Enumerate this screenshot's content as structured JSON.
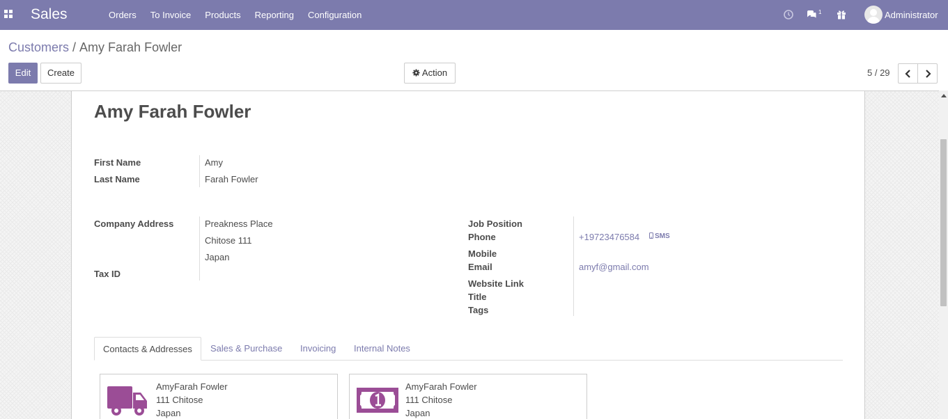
{
  "navbar": {
    "app_title": "Sales",
    "menu": [
      "Orders",
      "To Invoice",
      "Products",
      "Reporting",
      "Configuration"
    ],
    "chat_count": "1",
    "user_name": "Administrator"
  },
  "breadcrumb": {
    "parent": "Customers",
    "separator": "/",
    "current": "Amy Farah Fowler"
  },
  "buttons": {
    "edit": "Edit",
    "create": "Create",
    "action": "Action"
  },
  "pager": {
    "value": "5 / 29"
  },
  "partner": {
    "name": "Amy Farah Fowler",
    "first_name_label": "First Name",
    "first_name": "Amy",
    "last_name_label": "Last Name",
    "last_name": "Farah Fowler",
    "address_label": "Company Address",
    "street": "Preakness Place",
    "city_zip": "Chitose  111",
    "country": "Japan",
    "tax_id_label": "Tax ID",
    "job_position_label": "Job Position",
    "phone_label": "Phone",
    "phone": "+19723476584",
    "sms_label": "SMS",
    "mobile_label": "Mobile",
    "email_label": "Email",
    "email": "amyf@gmail.com",
    "website_label": "Website Link",
    "title_label": "Title",
    "tags_label": "Tags"
  },
  "tabs": [
    {
      "label": "Contacts & Addresses",
      "active": true
    },
    {
      "label": "Sales & Purchase",
      "active": false
    },
    {
      "label": "Invoicing",
      "active": false
    },
    {
      "label": "Internal Notes",
      "active": false
    }
  ],
  "contacts": [
    {
      "icon": "delivery-truck-icon",
      "name": "AmyFarah Fowler",
      "line2": "111 Chitose",
      "line3": "Japan"
    },
    {
      "icon": "invoice-money-icon",
      "name": "AmyFarah Fowler",
      "line2": "111 Chitose",
      "line3": "Japan"
    }
  ],
  "colors": {
    "brand": "#7c7bad",
    "card_icon": "#9b4d96"
  }
}
